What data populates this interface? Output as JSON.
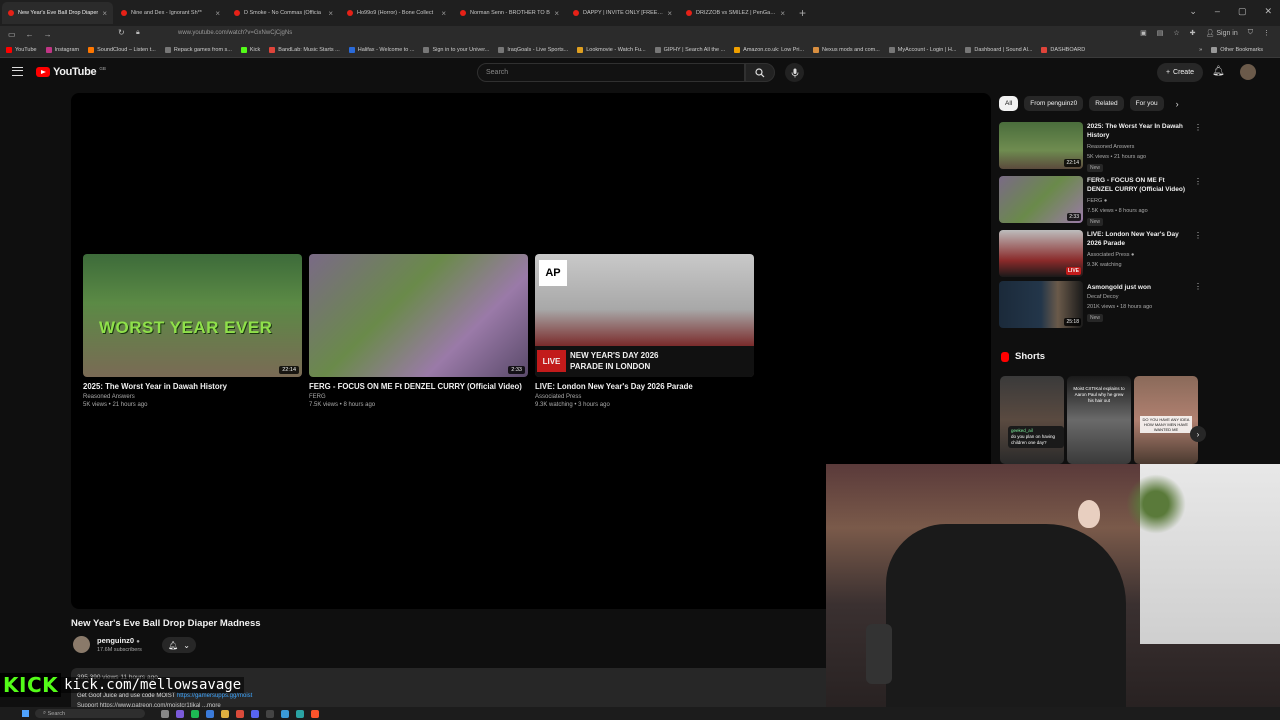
{
  "browser": {
    "tabs": [
      {
        "label": "New Year's Eve Ball Drop Diaper",
        "active": true
      },
      {
        "label": "Nine and Dex - Ignorant Sh** ",
        "active": false
      },
      {
        "label": "D Smoke - No Commas (Officia",
        "active": false
      },
      {
        "label": "Ho99o9 (Horror) - Bone Collect",
        "active": false
      },
      {
        "label": "Norman Senn - BROTHER TO B",
        "active": false
      },
      {
        "label": "DAPPY | INVITE ONLY [FREESTY",
        "active": false
      },
      {
        "label": "DRIZZOB vs SMILEZ | PenGame",
        "active": false
      }
    ],
    "url": "www.youtube.com/watch?v=GxNwCjCjgNs",
    "sign_in": "Sign in",
    "bookmarks": [
      "YouTube",
      "Instagram",
      "SoundCloud – Listen t...",
      "Repack games from s...",
      "Kick",
      "BandLab: Music Starts ...",
      "Halifax - Welcome to ...",
      "Sign in to your Univer...",
      "IraqGoals - Live Sports...",
      "Lookmovie - Watch Fu...",
      "GIPHY | Search All the ...",
      "Amazon.co.uk: Low Pri...",
      "Nexus mods and com...",
      "MyAccount - Login | H...",
      "Dashboard | Sound Al...",
      "DASHBOARD"
    ],
    "other_bookmarks": "Other Bookmarks"
  },
  "youtube": {
    "logo_text": "YouTube",
    "country_code": "GB",
    "search_placeholder": "Search",
    "create_label": "Create"
  },
  "player": {
    "endcards": [
      {
        "title": "2025: The Worst Year in Dawah History",
        "channel": "Reasoned Answers",
        "meta": "5K views • 21 hours ago",
        "duration": "22:14",
        "overlay": "WORST YEAR EVER"
      },
      {
        "title": "FERG - FOCUS ON ME Ft DENZEL CURRY (Official Video)",
        "channel": "FERG",
        "meta": "7.5K views • 8 hours ago",
        "duration": "2:33"
      },
      {
        "title": "LIVE: London New Year's Day 2026 Parade",
        "channel": "Associated Press",
        "meta": "9.3K watching • 3 hours ago",
        "badge": "AP",
        "live": "LIVE",
        "banner": "NEW YEAR'S DAY 2026 PARADE IN LONDON"
      }
    ]
  },
  "video": {
    "title": "New Year's Eve Ball Drop Diaper Madness",
    "channel": "penguinz0",
    "subscribers": "17.6M subscribers",
    "description": {
      "stats": "395,390 views  11 hours ago",
      "line1": "Get Goof Juice and use code MOIST ",
      "link": "https://gamersupps.gg/moist",
      "line2": "Support   https://www.patreon.com/moistcr1tikal  ...more"
    }
  },
  "sidebar": {
    "chips": [
      "All",
      "From penguinz0",
      "Related",
      "For you"
    ],
    "recommendations": [
      {
        "title": "2025: The Worst Year In Dawah History",
        "channel": "Reasoned Answers",
        "meta": "5K views • 21 hours ago",
        "badge": "New",
        "duration": "22:14"
      },
      {
        "title": "FERG - FOCUS ON ME Ft DENZEL CURRY (Official Video)",
        "channel": "FERG",
        "meta": "7.5K views • 8 hours ago",
        "badge": "New",
        "duration": "2:33"
      },
      {
        "title": "LIVE: London New Year's Day 2026 Parade",
        "channel": "Associated Press",
        "meta": "9.3K watching",
        "live": "LIVE"
      },
      {
        "title": "Asmongold just won",
        "channel": "Decaf Decoy",
        "meta": "201K views • 18 hours ago",
        "badge": "New",
        "duration": "25:18"
      }
    ],
    "shorts_label": "Shorts",
    "shorts": [
      {
        "caption": "do you plan on having children one day?",
        "user": "geeked_ail"
      },
      {
        "caption": "Moist CrITIKal explains to Aaron Paul why he grew his hair out"
      },
      {
        "caption": "DO YOU HAVE ANY IDEA HOW MANY MEN HAVE WANTED ME"
      }
    ]
  },
  "overlay": {
    "kick_logo": "KICK",
    "kick_url": "kick.com/mellowsavage"
  },
  "taskbar": {
    "search_label": "Search"
  },
  "colors": {
    "background": "#0f0f0f",
    "youtube_red": "#ff0000",
    "kick_green": "#53fc18",
    "link_blue": "#3ea6ff"
  }
}
